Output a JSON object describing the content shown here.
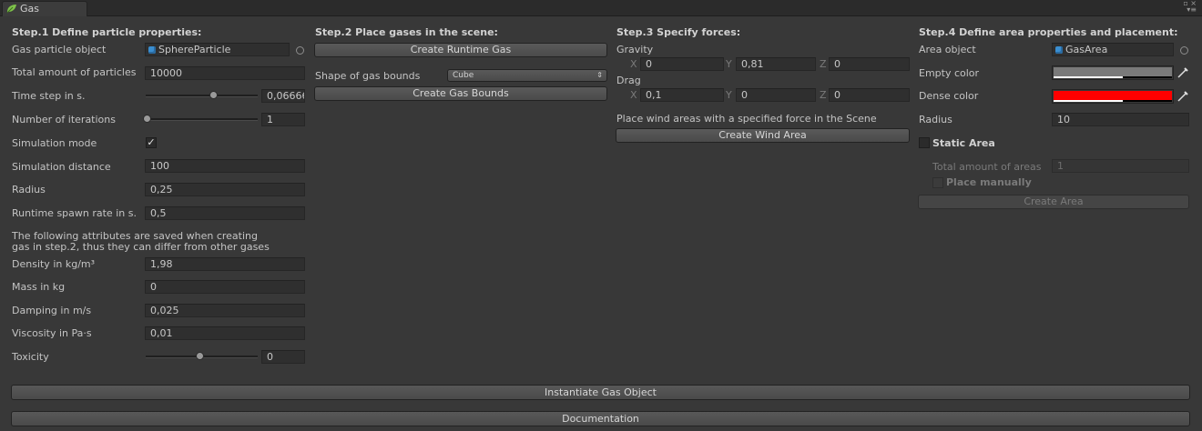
{
  "window": {
    "tab_title": "Gas"
  },
  "step1": {
    "header": "Step.1 Define particle properties:",
    "particle_object_label": "Gas particle object",
    "particle_object_value": "SphereParticle",
    "total_particles_label": "Total amount of particles",
    "total_particles_value": "10000",
    "time_step_label": "Time step in s.",
    "time_step_value": "0,06666",
    "iterations_label": "Number of iterations",
    "iterations_value": "1",
    "sim_mode_label": "Simulation mode",
    "sim_mode_checked": true,
    "sim_distance_label": "Simulation distance",
    "sim_distance_value": "100",
    "radius_label": "Radius",
    "radius_value": "0,25",
    "spawn_rate_label": "Runtime spawn rate in s.",
    "spawn_rate_value": "0,5",
    "note_line1": "The following attributes are saved when creating",
    "note_line2": "gas in step.2, thus they can differ from other gases",
    "density_label": "Density in kg/m³",
    "density_value": "1,98",
    "mass_label": "Mass in kg",
    "mass_value": "0",
    "damping_label": "Damping in m/s",
    "damping_value": "0,025",
    "viscosity_label": "Viscosity in Pa·s",
    "viscosity_value": "0,01",
    "toxicity_label": "Toxicity",
    "toxicity_value": "0"
  },
  "step2": {
    "header": "Step.2 Place gases in the scene:",
    "create_runtime_gas": "Create Runtime Gas",
    "shape_label": "Shape of gas bounds",
    "shape_value": "Cube",
    "create_gas_bounds": "Create Gas Bounds"
  },
  "step3": {
    "header": "Step.3 Specify forces:",
    "gravity_label": "Gravity",
    "gravity": {
      "x": "0",
      "y": "0,81",
      "z": "0"
    },
    "drag_label": "Drag",
    "drag": {
      "x": "0,1",
      "y": "0",
      "z": "0"
    },
    "axis": {
      "x": "X",
      "y": "Y",
      "z": "Z"
    },
    "wind_note": "Place wind areas with a specified force in the Scene",
    "create_wind_area": "Create Wind Area"
  },
  "step4": {
    "header": "Step.4 Define area properties and placement:",
    "area_object_label": "Area object",
    "area_object_value": "GasArea",
    "empty_color_label": "Empty color",
    "dense_color_label": "Dense color",
    "radius_label": "Radius",
    "radius_value": "10",
    "static_area_label": "Static Area",
    "total_areas_label": "Total amount of areas",
    "total_areas_value": "1",
    "place_manually_label": "Place manually",
    "create_area": "Create Area"
  },
  "footer": {
    "instantiate": "Instantiate Gas Object",
    "documentation": "Documentation"
  },
  "colors": {
    "empty_color": "#7a7a7a",
    "dense_color": "#ff0000",
    "background": "#383838"
  },
  "sliders": {
    "time_step_fraction": 0.55,
    "iterations_fraction": 0.0,
    "toxicity_fraction": 0.48
  }
}
